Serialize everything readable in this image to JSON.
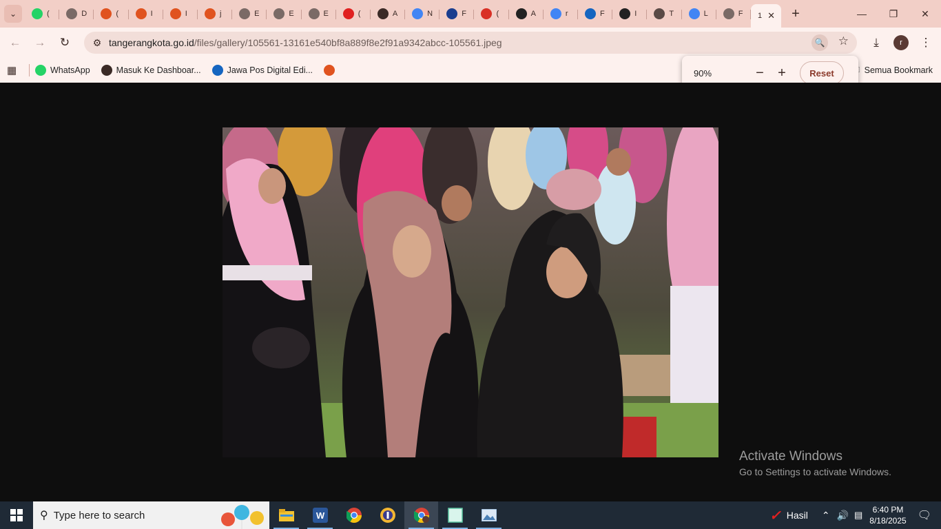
{
  "browser": {
    "tabs": [
      {
        "icon": "whatsapp-icon",
        "color": "#25d366",
        "short": "("
      },
      {
        "icon": "globe-icon",
        "color": "#7a6a66",
        "short": "D"
      },
      {
        "icon": "flame-icon",
        "color": "#e0531f",
        "short": "("
      },
      {
        "icon": "flame-icon",
        "color": "#e0531f",
        "short": "I"
      },
      {
        "icon": "flame-icon",
        "color": "#e0531f",
        "short": "I"
      },
      {
        "icon": "flame-icon",
        "color": "#e0531f",
        "short": "j"
      },
      {
        "icon": "aperture-icon",
        "color": "#7a6a66",
        "short": "E"
      },
      {
        "icon": "aperture-icon",
        "color": "#7a6a66",
        "short": "E"
      },
      {
        "icon": "aperture-icon",
        "color": "#7a6a66",
        "short": "E"
      },
      {
        "icon": "youtube-icon",
        "color": "#e02020",
        "short": "("
      },
      {
        "icon": "openai-icon",
        "color": "#3b2a26",
        "short": "A"
      },
      {
        "icon": "google-icon",
        "color": "#4285f4",
        "short": "N"
      },
      {
        "icon": "vector-icon",
        "color": "#1b3e8f",
        "short": "F"
      },
      {
        "icon": "gmail-icon",
        "color": "#d93025",
        "short": "("
      },
      {
        "icon": "pixiv-icon",
        "color": "#222222",
        "short": "A"
      },
      {
        "icon": "google-icon",
        "color": "#4285f4",
        "short": "r"
      },
      {
        "icon": "jp-icon",
        "color": "#1565c0",
        "short": "F"
      },
      {
        "icon": "pixiv-icon",
        "color": "#222222",
        "short": "I"
      },
      {
        "icon": "shield-icon",
        "color": "#5a4a46",
        "short": "T"
      },
      {
        "icon": "google-icon",
        "color": "#4285f4",
        "short": "L"
      },
      {
        "icon": "globe-icon",
        "color": "#7a6a66",
        "short": "F"
      }
    ],
    "active_tab_short": "1",
    "url_domain": "tangerangkota.go.id",
    "url_path": "/files/gallery/105561-13161e540bf8a889f8e2f91a9342abcc-105561.jpeg",
    "avatar_letter": "r",
    "bookmarks": [
      {
        "label": "WhatsApp",
        "icon": "whatsapp-icon",
        "color": "#25d366"
      },
      {
        "label": "Masuk Ke Dashboar...",
        "icon": "globe-icon",
        "color": "#3b2a26"
      },
      {
        "label": "Jawa Pos Digital Edi...",
        "icon": "jp-icon",
        "color": "#1565c0"
      },
      {
        "label": "",
        "icon": "jp-logo-icon",
        "color": "#e0531f"
      }
    ],
    "all_bookmarks_label": "Semua Bookmark"
  },
  "zoom_popup": {
    "value": "90%",
    "reset_label": "Reset"
  },
  "watermark": {
    "title": "Activate Windows",
    "subtitle": "Go to Settings to activate Windows."
  },
  "taskbar": {
    "search_placeholder": "Type here to search",
    "weather_label": "Hasil",
    "time": "6:40 PM",
    "date": "8/18/2025"
  }
}
